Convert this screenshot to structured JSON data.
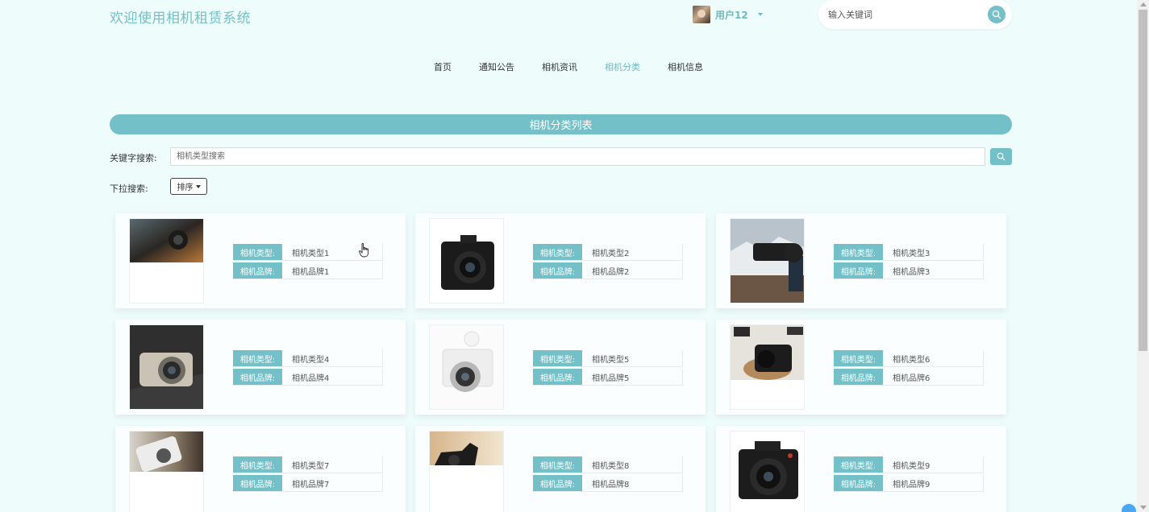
{
  "header": {
    "site_title": "欢迎使用相机租赁系统",
    "user_name": "用户12",
    "search_placeholder": "输入关键词"
  },
  "nav": {
    "items": [
      {
        "label": "首页",
        "active": false
      },
      {
        "label": "通知公告",
        "active": false
      },
      {
        "label": "相机资讯",
        "active": false
      },
      {
        "label": "相机分类",
        "active": true
      },
      {
        "label": "相机信息",
        "active": false
      }
    ]
  },
  "list": {
    "title": "相机分类列表",
    "keyword_label": "关键字搜索:",
    "keyword_placeholder": "相机类型搜索",
    "dropdown_label": "下拉搜索:",
    "sort_label": "排序"
  },
  "fields": {
    "type_label": "相机类型:",
    "brand_label": "相机品牌:"
  },
  "cards": [
    {
      "type": "相机类型1",
      "brand": "相机品牌1"
    },
    {
      "type": "相机类型2",
      "brand": "相机品牌2"
    },
    {
      "type": "相机类型3",
      "brand": "相机品牌3"
    },
    {
      "type": "相机类型4",
      "brand": "相机品牌4"
    },
    {
      "type": "相机类型5",
      "brand": "相机品牌5"
    },
    {
      "type": "相机类型6",
      "brand": "相机品牌6"
    },
    {
      "type": "相机类型7",
      "brand": "相机品牌7"
    },
    {
      "type": "相机类型8",
      "brand": "相机品牌8"
    },
    {
      "type": "相机类型9",
      "brand": "相机品牌9"
    }
  ],
  "colors": {
    "accent": "#74c0c8",
    "background": "#effcfc"
  }
}
